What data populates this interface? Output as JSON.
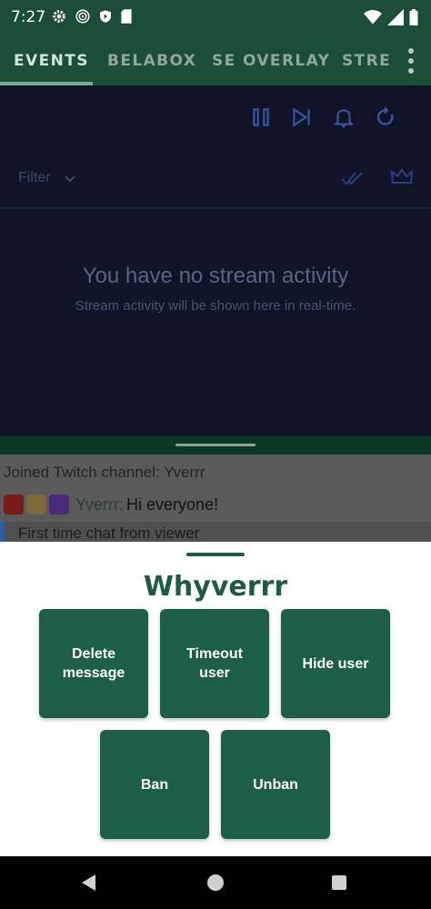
{
  "status_bar": {
    "time": "7:27",
    "icons": [
      "settings-icon",
      "spiral-icon",
      "shield-icon",
      "sd-card-icon",
      "wifi-icon",
      "signal-icon",
      "battery-icon"
    ]
  },
  "tabs": [
    {
      "label": "EVENTS",
      "active": true
    },
    {
      "label": "BELABOX",
      "active": false
    },
    {
      "label": "SE OVERLAY",
      "active": false
    },
    {
      "label": "STRE",
      "active": false
    }
  ],
  "toolbar": {
    "icons": [
      "pause-icon",
      "skip-next-icon",
      "bell-icon",
      "refresh-icon"
    ]
  },
  "filter": {
    "label": "Filter",
    "icons": [
      "double-check-icon",
      "crown-icon"
    ]
  },
  "empty_state": {
    "title": "You have no stream activity",
    "subtitle": "Stream activity will be shown here in real-time."
  },
  "chat": {
    "joined": "Joined Twitch channel: Yverrr",
    "message_author": "Yverrr:",
    "message_text": "Hi everyone!",
    "first_time": "First time chat from viewer"
  },
  "sheet": {
    "username": "Whyverrr",
    "buttons": {
      "delete": "Delete message",
      "timeout": "Timeout user",
      "hide": "Hide user",
      "ban": "Ban",
      "unban": "Unban"
    }
  },
  "colors": {
    "primary": "#1d5e49",
    "header": "#1b4d3a",
    "main_bg": "#0f1427",
    "icon_blue": "#3a55a8"
  }
}
